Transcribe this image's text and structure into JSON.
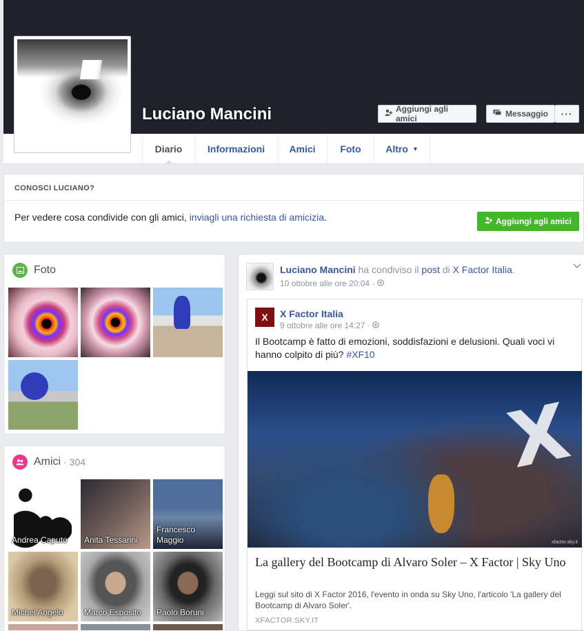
{
  "profile": {
    "name": "Luciano Mancini",
    "buttons": {
      "add_friend": "Aggiungi agli amici",
      "message": "Messaggio",
      "more": "···"
    }
  },
  "tabs": [
    {
      "label": "Diario"
    },
    {
      "label": "Informazioni"
    },
    {
      "label": "Amici"
    },
    {
      "label": "Foto"
    },
    {
      "label": "Altro"
    }
  ],
  "know": {
    "header": "CONOSCI LUCIANO?",
    "text": "Per vedere cosa condivide con gli amici, ",
    "link": "inviagli una richiesta di amicizia",
    "end": ".",
    "button": "Aggiungi agli amici"
  },
  "photos": {
    "title": "Foto"
  },
  "friends": {
    "title": "Amici",
    "count": "· 304",
    "items": [
      {
        "name": "Andrea Caputo"
      },
      {
        "name": "Anita Tessarini"
      },
      {
        "name": "Francesco Maggio"
      },
      {
        "name": "Michel Angelo"
      },
      {
        "name": "Marco Esposito"
      },
      {
        "name": "Paolo Boruni"
      }
    ]
  },
  "post": {
    "author": "Luciano Mancini",
    "action": " ha condiviso il ",
    "object": "post",
    "of": " di ",
    "source": "X Factor Italia",
    "end": ".",
    "time": "10 ottobre alle ore 20:04 · ",
    "shared": {
      "page": "X Factor Italia",
      "time": "9 ottobre alle ore 14:27 · ",
      "text": "Il Bootcamp è fatto di emozioni, soddisfazioni e delusioni. Quali voci vi hanno colpito di più? ",
      "hashtag": "#XF10",
      "photo_credit": "xfactor.sky.it",
      "link_title": "La gallery del Bootcamp di Alvaro Soler – X Factor | Sky Uno",
      "link_desc": "Leggi sul sito di X Factor 2016, l'evento in onda su Sky Uno, l'articolo 'La gallery del Bootcamp di Alvaro Soler'.",
      "link_source": "XFACTOR.SKY.IT"
    }
  },
  "icons": {
    "add_friend": "add-friend-icon",
    "message": "message-icon",
    "photo": "photo-icon",
    "friends": "friends-icon",
    "globe": "globe-icon",
    "chevron": "chevron-down-icon"
  },
  "colors": {
    "link": "#365899",
    "green": "#42b72a",
    "cover": "#1f222a",
    "background": "#e9ebee"
  }
}
